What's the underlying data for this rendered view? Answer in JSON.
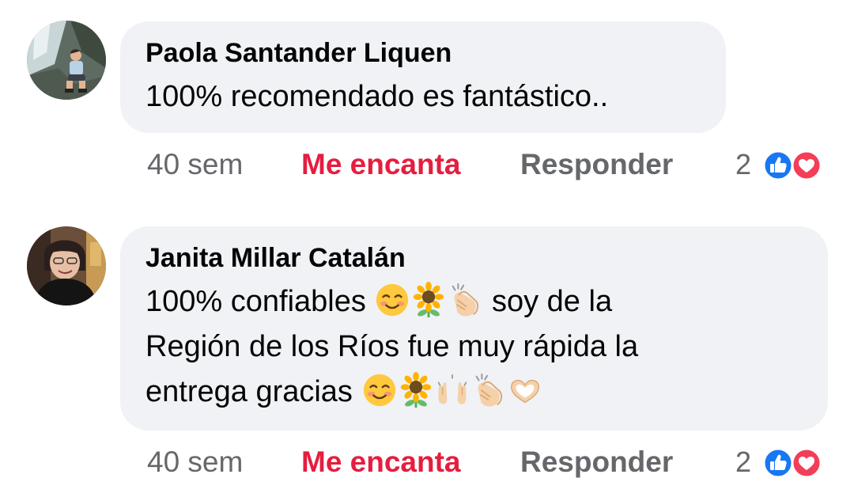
{
  "comments": [
    {
      "author": "Paola Santander Liquen",
      "text": "100% recomendado es fantástico..",
      "time": "40 sem",
      "love_label": "Me encanta",
      "reply_label": "Responder",
      "reaction_count": "2",
      "reactions": [
        "like-icon",
        "heart-icon"
      ]
    },
    {
      "author": "Janita Millar Catalán",
      "text_parts": [
        "100% confiables ",
        " soy de la",
        "Región de los Ríos fue muy rápida la",
        "entrega gracias "
      ],
      "emojis_line1": [
        "smiling-face-icon",
        "sunflower-icon",
        "clapping-hands-icon"
      ],
      "emojis_line3": [
        "smiling-face-icon",
        "sunflower-icon",
        "raising-hands-icon",
        "clapping-hands-icon",
        "heart-hands-icon"
      ],
      "time": "40 sem",
      "love_label": "Me encanta",
      "reply_label": "Responder",
      "reaction_count": "2",
      "reactions": [
        "like-icon",
        "heart-icon"
      ]
    }
  ],
  "colors": {
    "bubble": "#f0f2f5",
    "love": "#e41e3f",
    "muted": "#65676b",
    "like_blue": "#1877f2",
    "heart_red": "#f33e58"
  }
}
